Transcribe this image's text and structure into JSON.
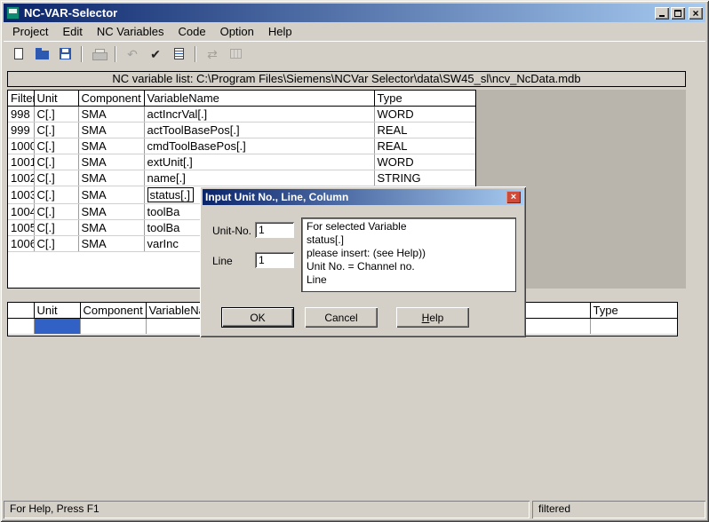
{
  "colors": {
    "face": "#d4d0c8",
    "title_grad_start": "#0a246a",
    "title_grad_end": "#a6caf0",
    "selection": "#3161c4",
    "dialog_close": "#cf4a38"
  },
  "icons": {
    "close_glyph": "×"
  },
  "window": {
    "title": "NC-VAR-Selector"
  },
  "menu": {
    "items": [
      "Project",
      "Edit",
      "NC Variables",
      "Code",
      "Option",
      "Help"
    ]
  },
  "toolbar": {
    "buttons": [
      {
        "name": "new",
        "glyph": "",
        "enabled": true
      },
      {
        "name": "open",
        "glyph": "",
        "enabled": true
      },
      {
        "name": "save",
        "glyph": "",
        "enabled": true
      },
      {
        "name": "print",
        "glyph": "",
        "enabled": false
      },
      {
        "name": "undo",
        "glyph": "↶",
        "enabled": false
      },
      {
        "name": "accept",
        "glyph": "✔",
        "enabled": true
      },
      {
        "name": "list",
        "glyph": "",
        "enabled": true
      },
      {
        "name": "transfer",
        "glyph": "⇄",
        "enabled": false
      },
      {
        "name": "grid",
        "glyph": "",
        "enabled": false
      }
    ]
  },
  "path_bar": {
    "text": "NC variable list:  C:\\Program Files\\Siemens\\NCVar Selector\\data\\SW45_sl\\ncv_NcData.mdb"
  },
  "main_table": {
    "columns": [
      "Filter",
      "Unit",
      "Component",
      "VariableName",
      "Type"
    ],
    "rows": [
      [
        "998",
        "C[.]",
        "SMA",
        "actIncrVal[.]",
        "WORD"
      ],
      [
        "999",
        "C[.]",
        "SMA",
        "actToolBasePos[.]",
        "REAL"
      ],
      [
        "1000",
        "C[.]",
        "SMA",
        "cmdToolBasePos[.]",
        "REAL"
      ],
      [
        "1001",
        "C[.]",
        "SMA",
        "extUnit[.]",
        "WORD"
      ],
      [
        "1002",
        "C[.]",
        "SMA",
        "name[.]",
        "STRING"
      ],
      [
        "1003",
        "C[.]",
        "SMA",
        "status[.]",
        ""
      ],
      [
        "1004",
        "C[.]",
        "SMA",
        "toolBa",
        ""
      ],
      [
        "1005",
        "C[.]",
        "SMA",
        "toolBa",
        ""
      ],
      [
        "1006",
        "C[.]",
        "SMA",
        "varInc",
        ""
      ]
    ]
  },
  "sel_table": {
    "columns": [
      "",
      "Unit",
      "Component",
      "VariableName",
      "Type"
    ],
    "rows": [
      [
        "",
        "",
        "",
        "",
        ""
      ]
    ]
  },
  "dialog": {
    "title": "Input Unit No., Line, Column",
    "fields": [
      {
        "label": "Unit-No.",
        "value": "1"
      },
      {
        "label": "Line",
        "value": "1"
      }
    ],
    "info_lines": [
      "For selected Variable",
      "status[.]",
      "please insert: (see Help))",
      "Unit No. = Channel no.",
      "Line"
    ],
    "buttons": {
      "ok": "OK",
      "cancel": "Cancel",
      "help_initial": "H",
      "help_rest": "elp"
    }
  },
  "status_bar": {
    "left": "For Help, Press F1",
    "right": "filtered"
  }
}
